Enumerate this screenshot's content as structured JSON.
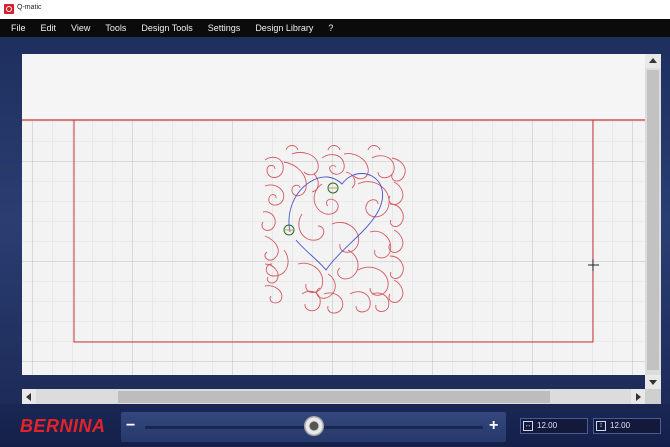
{
  "window": {
    "title": "Q-matic",
    "icon": "app-logo-icon"
  },
  "menu": [
    {
      "label": "File"
    },
    {
      "label": "Edit"
    },
    {
      "label": "View"
    },
    {
      "label": "Tools"
    },
    {
      "label": "Design Tools"
    },
    {
      "label": "Settings"
    },
    {
      "label": "Design Library"
    },
    {
      "label": "?"
    }
  ],
  "canvas": {
    "background": "#f3f3f3",
    "grid_color": "#c8c8c8",
    "quilt_boundary_color": "#c9343b",
    "design_stitch_color": "#d45a63",
    "path_color": "#4a55c8"
  },
  "scrollbars": {
    "vertical": "vertical-scrollbar",
    "horizontal": "horizontal-scrollbar"
  },
  "bottom": {
    "brand": "BERNINA",
    "brand_color": "#e3232a",
    "zoom": {
      "minus": "−",
      "plus": "+",
      "level_fraction": 0.5
    },
    "width": {
      "icon": "width-icon",
      "value": "12.00"
    },
    "height": {
      "icon": "height-icon",
      "value": "12.00"
    }
  }
}
